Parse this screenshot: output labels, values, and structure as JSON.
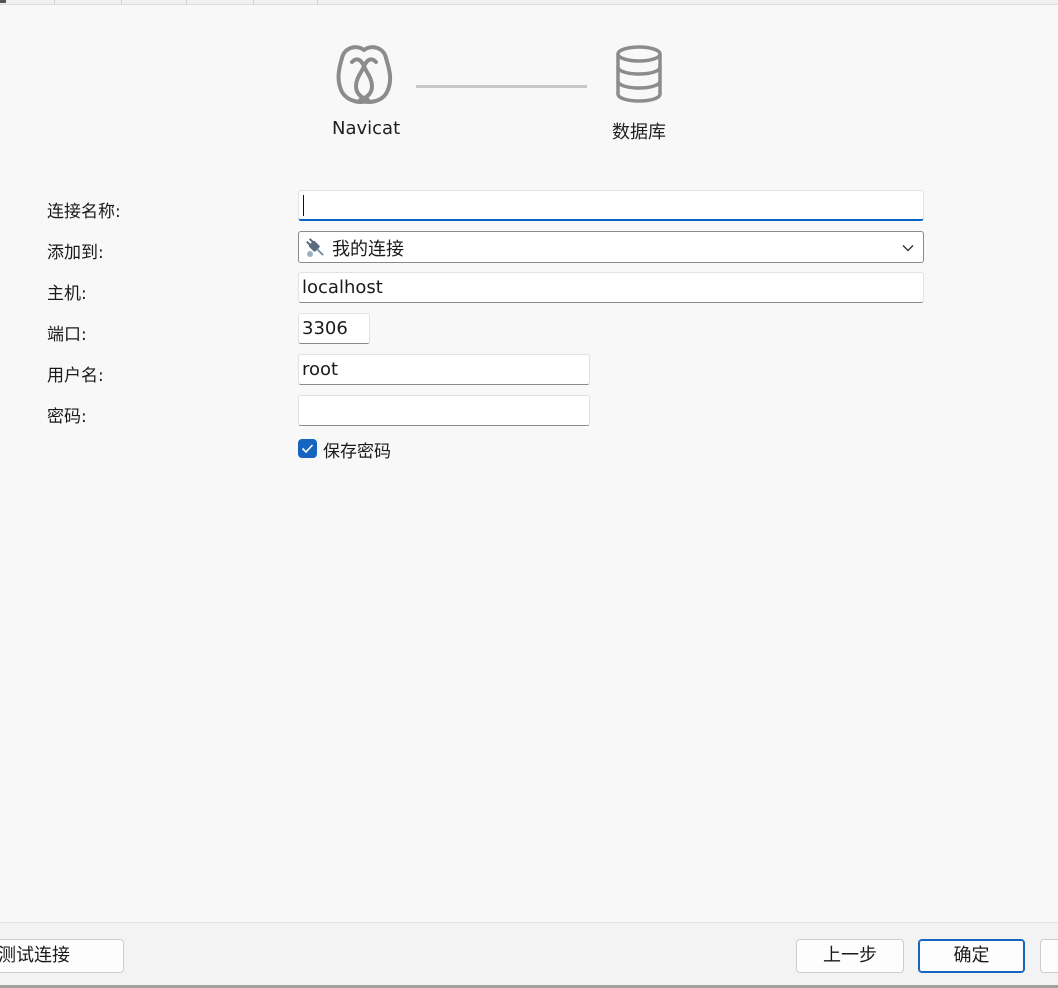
{
  "wizard": {
    "steps": [
      {
        "label": "Navicat",
        "icon": "navicat-logo-icon"
      },
      {
        "label": "数据库",
        "icon": "database-icon"
      }
    ]
  },
  "form": {
    "connection_name": {
      "label": "连接名称:",
      "value": ""
    },
    "add_to": {
      "label": "添加到:",
      "value": "我的连接",
      "icon": "plug-icon"
    },
    "host": {
      "label": "主机:",
      "value": "localhost"
    },
    "port": {
      "label": "端口:",
      "value": "3306"
    },
    "username": {
      "label": "用户名:",
      "value": "root"
    },
    "password": {
      "label": "密码:",
      "value": ""
    },
    "save_password": {
      "label": "保存密码",
      "checked": true
    }
  },
  "footer": {
    "test_connection_label": "测试连接",
    "back_label": "上一步",
    "ok_label": "确定"
  },
  "colors": {
    "accent": "#1565c0",
    "background": "#f8f8f8",
    "icon_gray": "#8c8c8c"
  }
}
